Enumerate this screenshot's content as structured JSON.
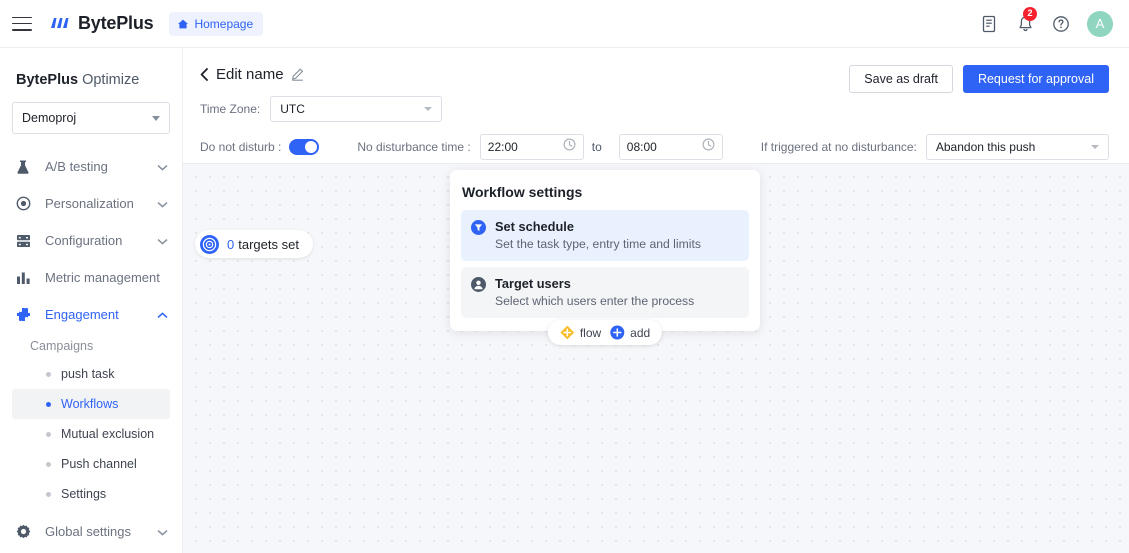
{
  "topbar": {
    "menu_icon": "hamburger-icon",
    "brand": "BytePlus",
    "homepage_label": "Homepage",
    "homepage_icon": "home-icon",
    "docs_icon": "document-icon",
    "bell_icon": "bell-icon",
    "notification_count": "2",
    "help_icon": "help-circle-icon",
    "avatar_initial": "A"
  },
  "sidebar": {
    "title_bold": "BytePlus",
    "title_light": " Optimize",
    "project": "Demoproj",
    "nav": [
      {
        "label": "A/B testing",
        "icon": "flask-icon",
        "chevron": "chevron-down-icon"
      },
      {
        "label": "Personalization",
        "icon": "target-dot-icon",
        "chevron": "chevron-down-icon"
      },
      {
        "label": "Configuration",
        "icon": "server-icon",
        "chevron": "chevron-down-icon"
      },
      {
        "label": "Metric management",
        "icon": "bar-chart-icon",
        "chevron": ""
      },
      {
        "label": "Engagement",
        "icon": "puzzle-icon",
        "chevron": "chevron-up-icon"
      }
    ],
    "group_label": "Campaigns",
    "sub_items": [
      {
        "label": "push task"
      },
      {
        "label": "Workflows"
      },
      {
        "label": "Mutual exclusion"
      },
      {
        "label": "Push channel"
      },
      {
        "label": "Settings"
      }
    ],
    "global_settings": {
      "label": "Global settings",
      "icon": "gear-icon",
      "chevron": "chevron-down-icon"
    }
  },
  "header": {
    "back_icon": "chevron-left-icon",
    "title": "Edit name",
    "edit_icon": "pencil-icon",
    "timezone_label": "Time Zone:",
    "timezone_value": "UTC",
    "dnd_label": "Do not disturb :",
    "dnd_enabled": true,
    "no_disturb_label": "No disturbance time :",
    "time_from": "22:00",
    "time_to_label": "to",
    "time_to": "08:00",
    "clock_icon": "clock-icon",
    "trigger_label": "If triggered at no disturbance:",
    "trigger_value": "Abandon this push",
    "save_draft_label": "Save as draft",
    "request_approval_label": "Request for approval"
  },
  "canvas": {
    "targets_chip": {
      "icon": "target-rings-icon",
      "count": "0",
      "text": "targets set"
    },
    "workflow_card": {
      "title": "Workflow settings",
      "rows": [
        {
          "icon": "funnel-icon",
          "heading": "Set schedule",
          "description": "Set the task type, entry time and limits"
        },
        {
          "icon": "user-icon",
          "heading": "Target users",
          "description": "Select which users enter the process"
        }
      ],
      "actions": [
        {
          "icon": "diamond-plus-icon",
          "label": "flow"
        },
        {
          "icon": "circle-plus-icon",
          "label": "add"
        }
      ]
    }
  },
  "colors": {
    "accent": "#2f63f5",
    "badge_red": "#f5222d",
    "avatar_green": "#8fd5c0",
    "flow_yellow": "#f7bd2a",
    "canvas_bg": "#f6f7fa"
  }
}
